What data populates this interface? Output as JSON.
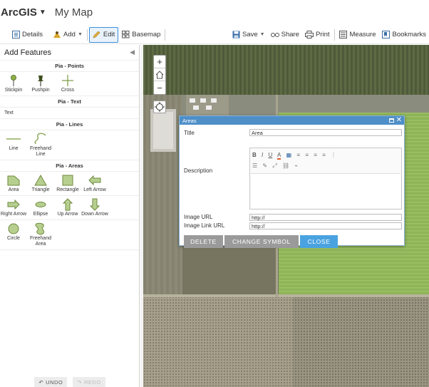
{
  "header": {
    "brand": "ArcGIS",
    "map_title": "My Map"
  },
  "toolbar": {
    "details": "Details",
    "add": "Add",
    "edit": "Edit",
    "basemap": "Basemap",
    "save": "Save",
    "share": "Share",
    "print": "Print",
    "measure": "Measure",
    "bookmarks": "Bookmarks"
  },
  "left_panel": {
    "title": "Add Features",
    "groups": {
      "points": {
        "title": "Pia - Points",
        "items": [
          "Stickpin",
          "Pushpin",
          "Cross"
        ]
      },
      "text": {
        "title": "Pia - Text",
        "items": [
          "Text"
        ]
      },
      "lines": {
        "title": "Pia - Lines",
        "items": [
          "Line",
          "Freehand Line"
        ]
      },
      "areas": {
        "title": "Pia - Areas",
        "items": [
          "Area",
          "Triangle",
          "Rectangle",
          "Left Arrow",
          "Right Arrow",
          "Ellipse",
          "Up Arrow",
          "Down Arrow",
          "Circle",
          "Freehand Area"
        ]
      }
    },
    "undo": "UNDO",
    "redo": "REDO"
  },
  "popup": {
    "title": "Areas",
    "title_label": "Title",
    "title_value": "Area",
    "description_label": "Description",
    "image_url_label": "Image URL",
    "image_url_value": "http://",
    "image_link_url_label": "Image Link URL",
    "image_link_url_value": "http://",
    "delete": "DELETE",
    "change_symbol": "CHANGE SYMBOL",
    "close": "CLOSE"
  },
  "colors": {
    "accent": "#3a8edb",
    "popup_header": "#4f8fc8",
    "close_button": "#4aa3e0",
    "symbol_fill": "#b7cf8e",
    "symbol_stroke": "#6e8a3f"
  }
}
